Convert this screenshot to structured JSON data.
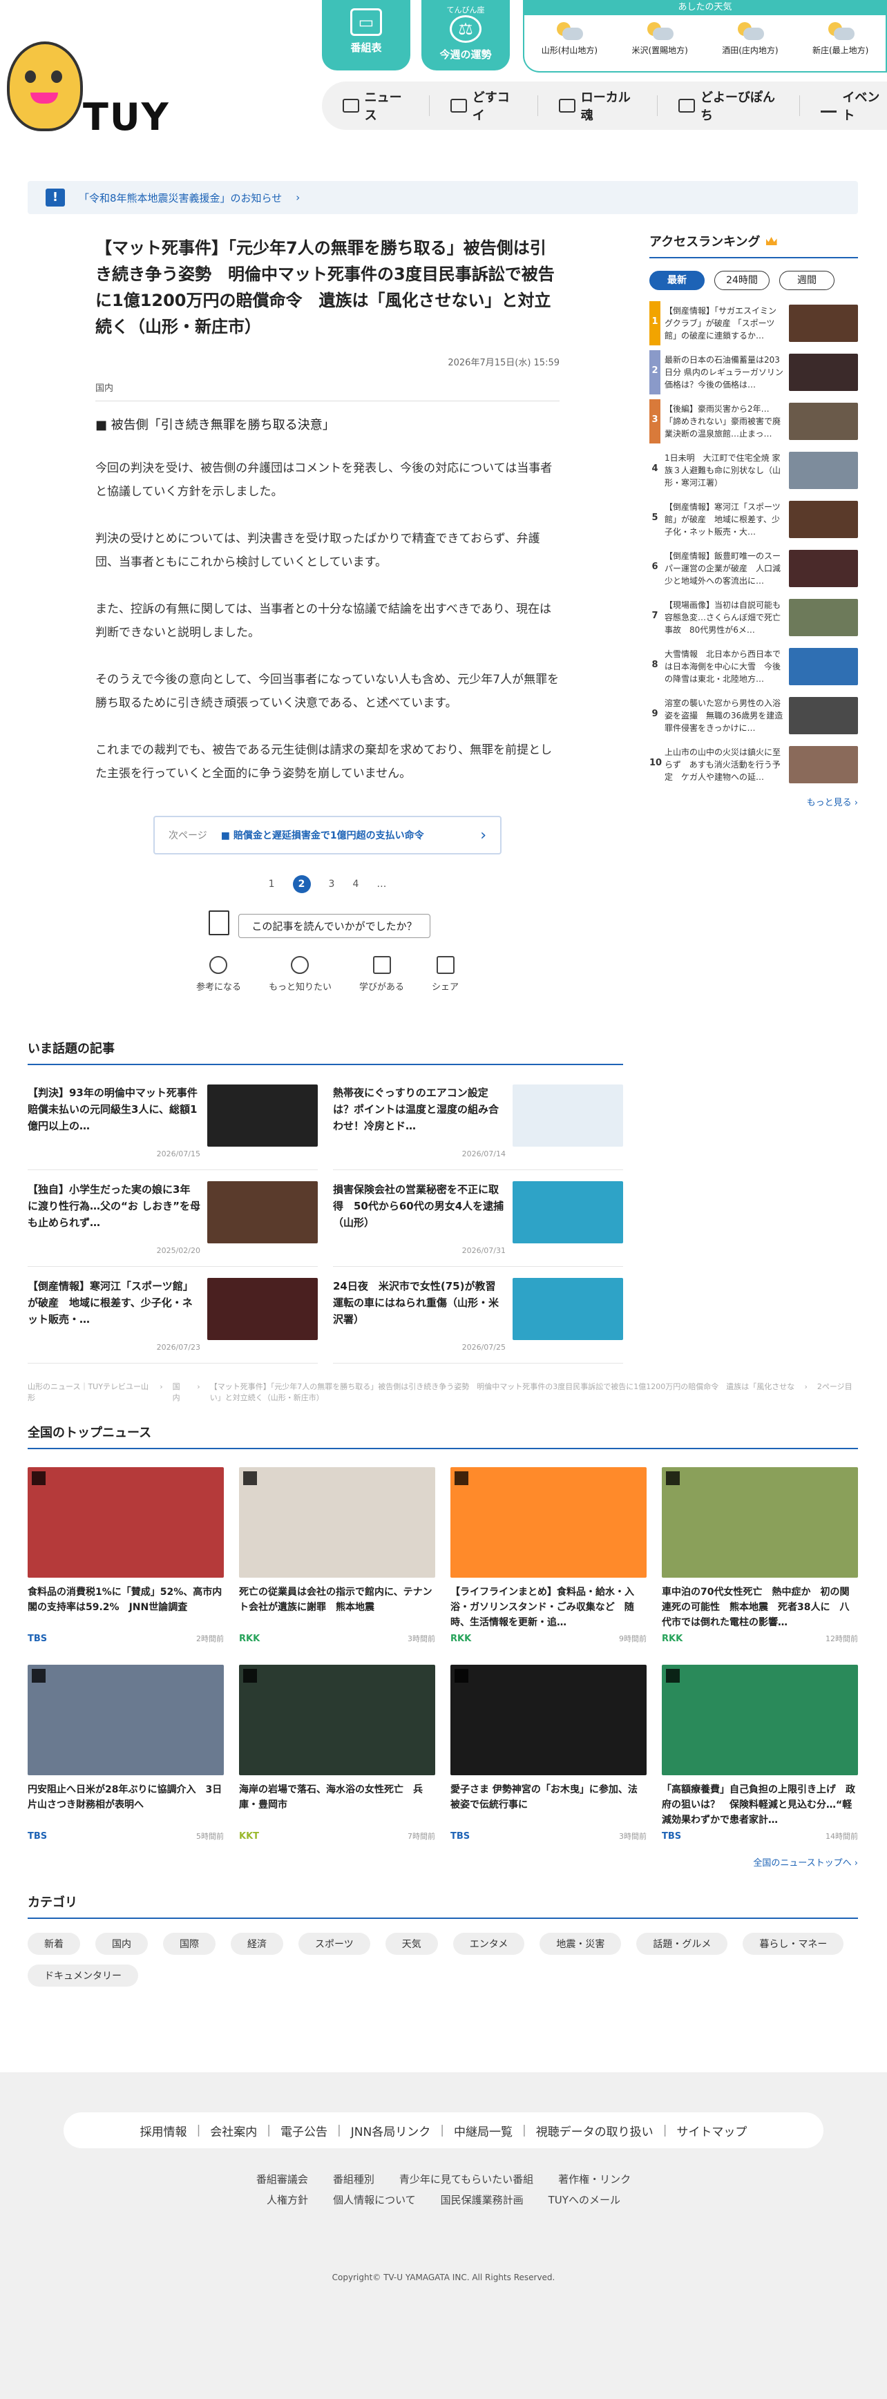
{
  "header": {
    "logo_text": "TUY",
    "buttons": [
      {
        "small": "",
        "label": "番組表",
        "icon": "tv-icon"
      },
      {
        "small": "てんびん座",
        "label": "今週の運勢",
        "icon": "scale-icon"
      }
    ],
    "weather": {
      "heading": "あしたの天気",
      "cities": [
        "山形(村山地方)",
        "米沢(置賜地方)",
        "酒田(庄内地方)",
        "新庄(最上地方)"
      ]
    },
    "nav": [
      "ニュース",
      "どすコイ",
      "ローカル魂",
      "どよーびぽんち",
      "イベント"
    ]
  },
  "notice": {
    "text": "「令和8年熊本地震災害義援金」のお知らせ"
  },
  "article": {
    "title": "【マット死事件】「元少年7人の無罪を勝ち取る」被告側は引き続き争う姿勢　明倫中マット死事件の3度目民事訴訟で被告に1億1200万円の賠償命令　遺族は「風化させない」と対立続く（山形・新庄市）",
    "date": "2026年7月15日(水) 15:59",
    "category": "国内",
    "subhead": "■ 被告側「引き続き無罪を勝ち取る決意」",
    "paragraphs": [
      "今回の判決を受け、被告側の弁護団はコメントを発表し、今後の対応については当事者と協議していく方針を示しました。",
      "判決の受けとめについては、判決書きを受け取ったばかりで精査できておらず、弁護団、当事者ともにこれから検討していくとしています。",
      "また、控訴の有無に関しては、当事者との十分な協議で結論を出すべきであり、現在は判断できないと説明しました。",
      "そのうえで今後の意向として、今回当事者になっていない人も含め、元少年7人が無罪を勝ち取るために引き続き頑張っていく決意である、と述べています。",
      "これまでの裁判でも、被告である元生徒側は請求の棄却を求めており、無罪を前提とした主張を行っていくと全面的に争う姿勢を崩していません。"
    ],
    "next_label": "次ページ",
    "next_title": "■ 賠償金と遅延損害金で1億円超の支払い命令",
    "pages": [
      "1",
      "2",
      "3",
      "4",
      "…"
    ],
    "current_page": "2",
    "feedback_q": "この記事を読んでいかがでしたか？",
    "reactions": [
      "参考になる",
      "もっと知りたい",
      "学びがある",
      "シェア"
    ]
  },
  "ranking": {
    "title": "アクセスランキング",
    "tabs": [
      "最新",
      "24時間",
      "週間"
    ],
    "items": [
      {
        "n": "1",
        "text": "【倒産情報】「サガエスイミングクラブ」が破産 「スポーツ館」の破産に連鎖するか…",
        "color": "#f2a400"
      },
      {
        "n": "2",
        "text": "最新の日本の石油備蓄量は203日分 県内のレギュラーガソリン価格は？今後の価格は…",
        "color": "#8a9ac9"
      },
      {
        "n": "3",
        "text": "【後編】豪雨災害から2年…「諦めきれない」豪雨被害で廃業決断の温泉旅館…止まっ…",
        "color": "#d97a3a"
      },
      {
        "n": "4",
        "text": "1日未明　大江町で住宅全焼 家族３人避難も命に別状なし（山形・寒河江署）",
        "color": "#fff"
      },
      {
        "n": "5",
        "text": "【倒産情報】寒河江「スポーツ館」が破産　地域に根差す、少子化・ネット販売・大…",
        "color": "#fff"
      },
      {
        "n": "6",
        "text": "【倒産情報】飯豊町唯一のスーパー運営の企業が破産　人口減少と地域外への客流出に…",
        "color": "#fff"
      },
      {
        "n": "7",
        "text": "【現場画像】当初は自説可能も容態急変…さくらんぼ畑で死亡事故　80代男性が6メ…",
        "color": "#fff"
      },
      {
        "n": "8",
        "text": "大雪情報　北日本から西日本では日本海側を中心に大雪　今後の降雪は東北・北陸地方…",
        "color": "#fff"
      },
      {
        "n": "9",
        "text": "溶室の襲いた窓から男性の入浴姿を盗撮　無職の36歳男を建造罪件侵害をきっかけに…",
        "color": "#fff"
      },
      {
        "n": "10",
        "text": "上山市の山中の火災は鎮火に至らず　あすも消火活動を行う予定　ケガ人や建物への延…",
        "color": "#fff"
      }
    ],
    "more": "もっと見る ›"
  },
  "hot": {
    "title": "いま話題の記事",
    "items": [
      {
        "text": "【判決】93年の明倫中マット死事件　賠償未払いの元同級生3人に、総額1億円以上の…",
        "date": "2026/07/15"
      },
      {
        "text": "熱帯夜にぐっすりのエアコン設定は？ポイントは温度と湿度の組み合わせ！冷房とド…",
        "date": "2026/07/14"
      },
      {
        "text": "【独自】小学生だった実の娘に3年に渡り性行為…父の“お しおき”を母も止められず…",
        "date": "2025/02/20"
      },
      {
        "text": "損害保険会社の営業秘密を不正に取得　50代から60代の男女4人を逮捕（山形）",
        "date": "2026/07/31"
      },
      {
        "text": "【倒産情報】寒河江「スポーツ館」が破産　地域に根差す、少子化・ネット販売・…",
        "date": "2026/07/23"
      },
      {
        "text": "24日夜　米沢市で女性(75)が教習運転の車にはねられ重傷（山形・米沢署）",
        "date": "2026/07/25"
      }
    ]
  },
  "breadcrumb": [
    "山形のニュース｜TUYテレビユー山形",
    "国内",
    "【マット死事件】「元少年7人の無罪を勝ち取る」被告側は引き続き争う姿勢　明倫中マット死事件の3度目民事訴訟で被告に1億1200万円の賠償命令　遺族は「風化させない」と対立続く（山形・新庄市）",
    "2ページ目"
  ],
  "national": {
    "title": "全国のトップニュース",
    "items": [
      {
        "text": "食料品の消費税1%に「賛成」52%、高市内閣の支持率は59.2%　JNN世論調査",
        "src": "TBS",
        "cls": "tbs",
        "time": "2時間前"
      },
      {
        "text": "死亡の従業員は会社の指示で館内に、テナント会社が遺族に謝罪　熊本地震",
        "src": "RKK",
        "cls": "rkk",
        "time": "3時間前"
      },
      {
        "text": "【ライフラインまとめ】食料品・給水・入浴・ガソリンスタンド・ごみ収集など　随時、生活情報を更新・追…",
        "src": "RKK",
        "cls": "rkk",
        "time": "9時間前"
      },
      {
        "text": "車中泊の70代女性死亡　熱中症か　初の関連死の可能性　熊本地震　死者38人に　八代市では倒れた電柱の影響…",
        "src": "RKK",
        "cls": "rkk",
        "time": "12時間前"
      },
      {
        "text": "円安阻止へ日米が28年ぶりに協調介入　3日 片山さつき財務相が表明へ",
        "src": "TBS",
        "cls": "tbs",
        "time": "5時間前"
      },
      {
        "text": "海岸の岩場で落石、海水浴の女性死亡　兵庫・豊岡市",
        "src": "KKT",
        "cls": "kkt",
        "time": "7時間前"
      },
      {
        "text": "愛子さま 伊勢神宮の「お木曳」に参加、法被姿で伝統行事に",
        "src": "TBS",
        "cls": "tbs",
        "time": "3時間前"
      },
      {
        "text": "「高額療養費」自己負担の上限引き上げ　政府の狙いは？　保険料軽減と見込む分…“軽減効果わずかで患者家計…",
        "src": "TBS",
        "cls": "tbs",
        "time": "14時間前"
      }
    ],
    "more": "全国のニューストップへ ›"
  },
  "category": {
    "title": "カテゴリ",
    "tags": [
      "新着",
      "国内",
      "国際",
      "経済",
      "スポーツ",
      "天気",
      "エンタメ",
      "地震・災害",
      "話題・グルメ",
      "暮らし・マネー",
      "ドキュメンタリー"
    ]
  },
  "footer": {
    "links": [
      "採用情報",
      "会社案内",
      "電子公告",
      "JNN各局リンク",
      "中継局一覧",
      "視聴データの取り扱い",
      "サイトマップ"
    ],
    "links2_row1": [
      "番組審議会",
      "番組種別",
      "青少年に見てもらいたい番組",
      "著作権・リンク"
    ],
    "links2_row2": [
      "人権方針",
      "個人情報について",
      "国民保護業務計画",
      "TUYへのメール"
    ],
    "copyright": "Copyright© TV-U YAMAGATA INC. All Rights Reserved."
  }
}
